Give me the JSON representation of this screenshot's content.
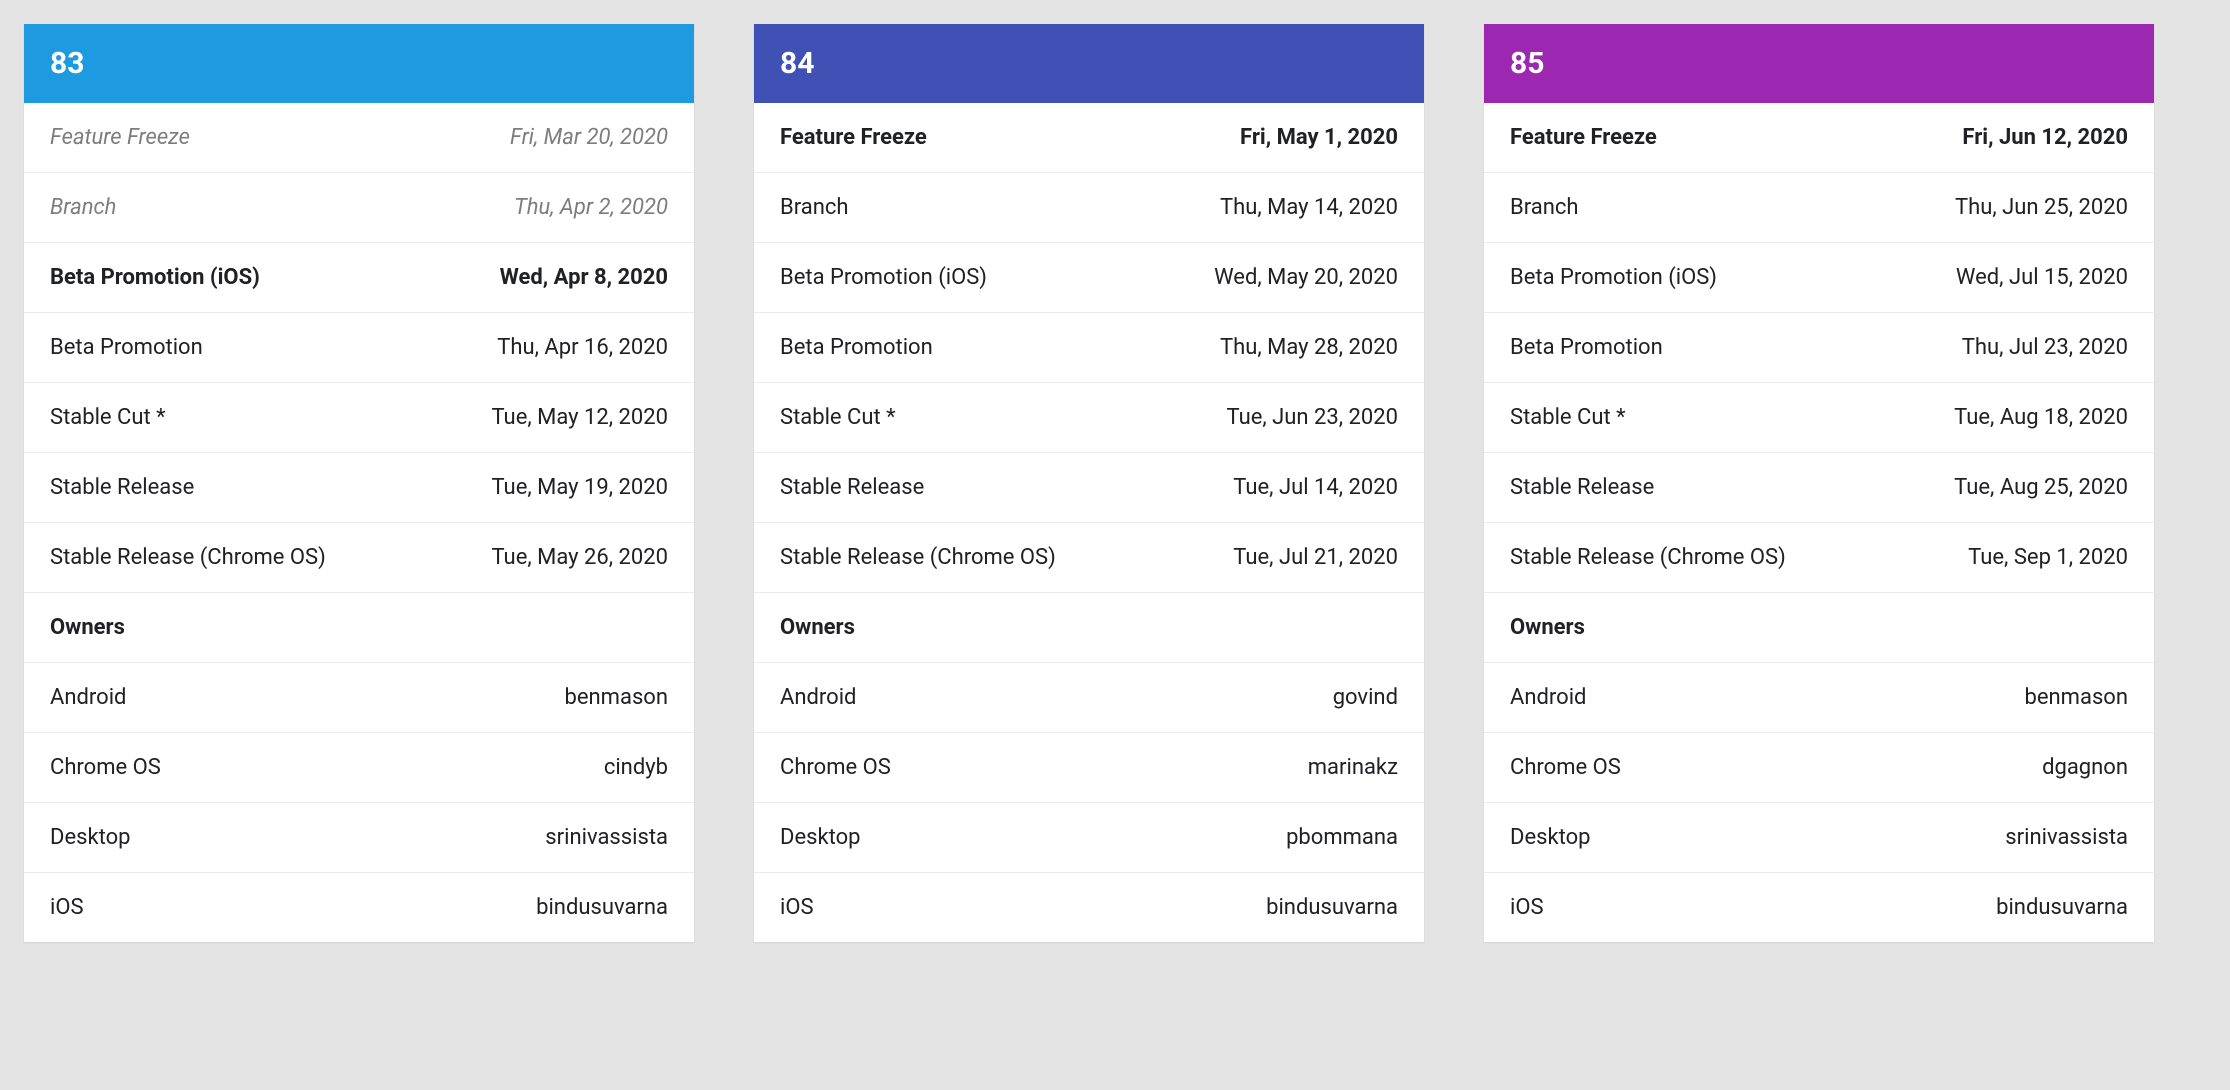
{
  "releases": [
    {
      "version": "83",
      "header_color": "#1e9be0",
      "milestones": [
        {
          "label": "Feature Freeze",
          "date": "Fri, Mar 20, 2020",
          "muted": true
        },
        {
          "label": "Branch",
          "date": "Thu, Apr 2, 2020",
          "muted": true
        },
        {
          "label": "Beta Promotion (iOS)",
          "date": "Wed, Apr 8, 2020",
          "bold": true
        },
        {
          "label": "Beta Promotion",
          "date": "Thu, Apr 16, 2020"
        },
        {
          "label": "Stable Cut *",
          "date": "Tue, May 12, 2020"
        },
        {
          "label": "Stable Release",
          "date": "Tue, May 19, 2020"
        },
        {
          "label": "Stable Release (Chrome OS)",
          "date": "Tue, May 26, 2020"
        }
      ],
      "owners_title": "Owners",
      "owners": [
        {
          "platform": "Android",
          "owner": "benmason"
        },
        {
          "platform": "Chrome OS",
          "owner": "cindyb"
        },
        {
          "platform": "Desktop",
          "owner": "srinivassista"
        },
        {
          "platform": "iOS",
          "owner": "bindusuvarna"
        }
      ]
    },
    {
      "version": "84",
      "header_color": "#3f51b5",
      "milestones": [
        {
          "label": "Feature Freeze",
          "date": "Fri, May 1, 2020",
          "bold": true
        },
        {
          "label": "Branch",
          "date": "Thu, May 14, 2020"
        },
        {
          "label": "Beta Promotion (iOS)",
          "date": "Wed, May 20, 2020"
        },
        {
          "label": "Beta Promotion",
          "date": "Thu, May 28, 2020"
        },
        {
          "label": "Stable Cut *",
          "date": "Tue, Jun 23, 2020"
        },
        {
          "label": "Stable Release",
          "date": "Tue, Jul 14, 2020"
        },
        {
          "label": "Stable Release (Chrome OS)",
          "date": "Tue, Jul 21, 2020"
        }
      ],
      "owners_title": "Owners",
      "owners": [
        {
          "platform": "Android",
          "owner": "govind"
        },
        {
          "platform": "Chrome OS",
          "owner": "marinakz"
        },
        {
          "platform": "Desktop",
          "owner": "pbommana"
        },
        {
          "platform": "iOS",
          "owner": "bindusuvarna"
        }
      ]
    },
    {
      "version": "85",
      "header_color": "#9c27b0",
      "milestones": [
        {
          "label": "Feature Freeze",
          "date": "Fri, Jun 12, 2020",
          "bold": true
        },
        {
          "label": "Branch",
          "date": "Thu, Jun 25, 2020"
        },
        {
          "label": "Beta Promotion (iOS)",
          "date": "Wed, Jul 15, 2020"
        },
        {
          "label": "Beta Promotion",
          "date": "Thu, Jul 23, 2020"
        },
        {
          "label": "Stable Cut *",
          "date": "Tue, Aug 18, 2020"
        },
        {
          "label": "Stable Release",
          "date": "Tue, Aug 25, 2020"
        },
        {
          "label": "Stable Release (Chrome OS)",
          "date": "Tue, Sep 1, 2020"
        }
      ],
      "owners_title": "Owners",
      "owners": [
        {
          "platform": "Android",
          "owner": "benmason"
        },
        {
          "platform": "Chrome OS",
          "owner": "dgagnon"
        },
        {
          "platform": "Desktop",
          "owner": "srinivassista"
        },
        {
          "platform": "iOS",
          "owner": "bindusuvarna"
        }
      ]
    }
  ]
}
